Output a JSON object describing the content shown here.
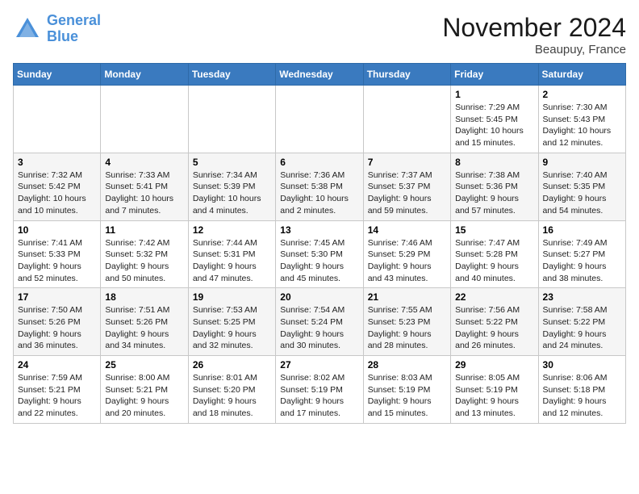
{
  "logo": {
    "line1": "General",
    "line2": "Blue"
  },
  "title": "November 2024",
  "location": "Beaupuy, France",
  "weekdays": [
    "Sunday",
    "Monday",
    "Tuesday",
    "Wednesday",
    "Thursday",
    "Friday",
    "Saturday"
  ],
  "weeks": [
    [
      {
        "day": "",
        "info": ""
      },
      {
        "day": "",
        "info": ""
      },
      {
        "day": "",
        "info": ""
      },
      {
        "day": "",
        "info": ""
      },
      {
        "day": "",
        "info": ""
      },
      {
        "day": "1",
        "info": "Sunrise: 7:29 AM\nSunset: 5:45 PM\nDaylight: 10 hours and 15 minutes."
      },
      {
        "day": "2",
        "info": "Sunrise: 7:30 AM\nSunset: 5:43 PM\nDaylight: 10 hours and 12 minutes."
      }
    ],
    [
      {
        "day": "3",
        "info": "Sunrise: 7:32 AM\nSunset: 5:42 PM\nDaylight: 10 hours and 10 minutes."
      },
      {
        "day": "4",
        "info": "Sunrise: 7:33 AM\nSunset: 5:41 PM\nDaylight: 10 hours and 7 minutes."
      },
      {
        "day": "5",
        "info": "Sunrise: 7:34 AM\nSunset: 5:39 PM\nDaylight: 10 hours and 4 minutes."
      },
      {
        "day": "6",
        "info": "Sunrise: 7:36 AM\nSunset: 5:38 PM\nDaylight: 10 hours and 2 minutes."
      },
      {
        "day": "7",
        "info": "Sunrise: 7:37 AM\nSunset: 5:37 PM\nDaylight: 9 hours and 59 minutes."
      },
      {
        "day": "8",
        "info": "Sunrise: 7:38 AM\nSunset: 5:36 PM\nDaylight: 9 hours and 57 minutes."
      },
      {
        "day": "9",
        "info": "Sunrise: 7:40 AM\nSunset: 5:35 PM\nDaylight: 9 hours and 54 minutes."
      }
    ],
    [
      {
        "day": "10",
        "info": "Sunrise: 7:41 AM\nSunset: 5:33 PM\nDaylight: 9 hours and 52 minutes."
      },
      {
        "day": "11",
        "info": "Sunrise: 7:42 AM\nSunset: 5:32 PM\nDaylight: 9 hours and 50 minutes."
      },
      {
        "day": "12",
        "info": "Sunrise: 7:44 AM\nSunset: 5:31 PM\nDaylight: 9 hours and 47 minutes."
      },
      {
        "day": "13",
        "info": "Sunrise: 7:45 AM\nSunset: 5:30 PM\nDaylight: 9 hours and 45 minutes."
      },
      {
        "day": "14",
        "info": "Sunrise: 7:46 AM\nSunset: 5:29 PM\nDaylight: 9 hours and 43 minutes."
      },
      {
        "day": "15",
        "info": "Sunrise: 7:47 AM\nSunset: 5:28 PM\nDaylight: 9 hours and 40 minutes."
      },
      {
        "day": "16",
        "info": "Sunrise: 7:49 AM\nSunset: 5:27 PM\nDaylight: 9 hours and 38 minutes."
      }
    ],
    [
      {
        "day": "17",
        "info": "Sunrise: 7:50 AM\nSunset: 5:26 PM\nDaylight: 9 hours and 36 minutes."
      },
      {
        "day": "18",
        "info": "Sunrise: 7:51 AM\nSunset: 5:26 PM\nDaylight: 9 hours and 34 minutes."
      },
      {
        "day": "19",
        "info": "Sunrise: 7:53 AM\nSunset: 5:25 PM\nDaylight: 9 hours and 32 minutes."
      },
      {
        "day": "20",
        "info": "Sunrise: 7:54 AM\nSunset: 5:24 PM\nDaylight: 9 hours and 30 minutes."
      },
      {
        "day": "21",
        "info": "Sunrise: 7:55 AM\nSunset: 5:23 PM\nDaylight: 9 hours and 28 minutes."
      },
      {
        "day": "22",
        "info": "Sunrise: 7:56 AM\nSunset: 5:22 PM\nDaylight: 9 hours and 26 minutes."
      },
      {
        "day": "23",
        "info": "Sunrise: 7:58 AM\nSunset: 5:22 PM\nDaylight: 9 hours and 24 minutes."
      }
    ],
    [
      {
        "day": "24",
        "info": "Sunrise: 7:59 AM\nSunset: 5:21 PM\nDaylight: 9 hours and 22 minutes."
      },
      {
        "day": "25",
        "info": "Sunrise: 8:00 AM\nSunset: 5:21 PM\nDaylight: 9 hours and 20 minutes."
      },
      {
        "day": "26",
        "info": "Sunrise: 8:01 AM\nSunset: 5:20 PM\nDaylight: 9 hours and 18 minutes."
      },
      {
        "day": "27",
        "info": "Sunrise: 8:02 AM\nSunset: 5:19 PM\nDaylight: 9 hours and 17 minutes."
      },
      {
        "day": "28",
        "info": "Sunrise: 8:03 AM\nSunset: 5:19 PM\nDaylight: 9 hours and 15 minutes."
      },
      {
        "day": "29",
        "info": "Sunrise: 8:05 AM\nSunset: 5:19 PM\nDaylight: 9 hours and 13 minutes."
      },
      {
        "day": "30",
        "info": "Sunrise: 8:06 AM\nSunset: 5:18 PM\nDaylight: 9 hours and 12 minutes."
      }
    ]
  ]
}
